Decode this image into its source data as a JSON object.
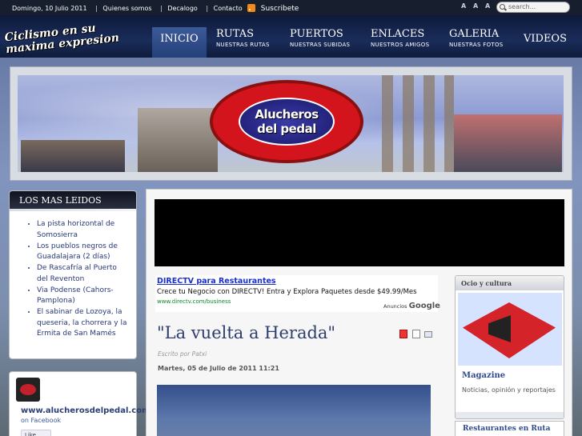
{
  "topbar": {
    "date": "Domingo, 10 Julio 2011",
    "links": [
      "Quienes somos",
      "Decalogo",
      "Contacto"
    ],
    "subscribe": "Suscribete",
    "font_tools": "A A A",
    "search_placeholder": "search..."
  },
  "nav": {
    "logo_line1": "Ciclismo en su",
    "logo_line2": "maxima expresion",
    "items": [
      {
        "label": "INICIO",
        "sub": ""
      },
      {
        "label": "RUTAS",
        "sub": "NUESTRAS RUTAS"
      },
      {
        "label": "PUERTOS",
        "sub": "NUESTRAS SUBIDAS"
      },
      {
        "label": "ENLACES",
        "sub": "NUESTROS AMIGOS"
      },
      {
        "label": "GALERIA",
        "sub": "NUESTRAS FOTOS"
      },
      {
        "label": "VIDEOS",
        "sub": ""
      }
    ]
  },
  "banner": {
    "logo_line1": "Alucheros",
    "logo_line2": "del pedal"
  },
  "most_read": {
    "title": "LOS MAS LEIDOS",
    "items": [
      "La pista horizontal de Somosierra",
      "Los pueblos negros de Guadalajara (2 días)",
      "De Rascafría al Puerto del Reventon",
      "Via Podense (Cahors-Pamplona)",
      "El sabinar de Lozoya, la queseria, la chorrera y la Ermita de San Mamés"
    ]
  },
  "facebook": {
    "url": "www.alucherosdelpedal.com",
    "on": "on Facebook",
    "like": "Like"
  },
  "ad": {
    "title": "DIRECTV para Restaurantes",
    "desc": "Crece tu Negocio con DIRECTV! Entra y Explora Paquetes desde $49.99/Mes",
    "link": "www.directv.com/business",
    "by_label": "Anuncios",
    "by_brand": "Google"
  },
  "article": {
    "title": "\"La vuelta a Herada\"",
    "author": "Escrito por Patxi",
    "date": "Martes, 05 de Julio de 2011 11:21"
  },
  "ocio": {
    "title": "Ocio y cultura",
    "name": "Magazine",
    "desc": "Noticias, opinión y reportajes"
  },
  "restaurantes": {
    "title": "Restaurantes en Ruta"
  },
  "colors": {
    "nav_bg": "#1a2c5a",
    "active_tab": "#2d4a88",
    "link": "#26387a",
    "accent_red": "#d42329"
  }
}
